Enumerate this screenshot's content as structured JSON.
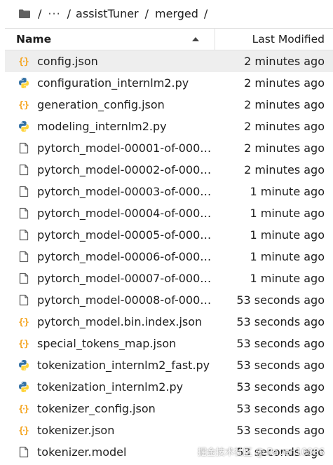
{
  "breadcrumb": {
    "ellipsis": "···",
    "sep1": "/",
    "sep2": "/",
    "sep3": "/",
    "sep4": "/",
    "folder1": "assistTuner",
    "folder2": "merged"
  },
  "header": {
    "name_label": "Name",
    "modified_label": "Last Modified"
  },
  "files": [
    {
      "name": "config.json",
      "modified": "2 minutes ago",
      "icon": "json-icon"
    },
    {
      "name": "configuration_internlm2.py",
      "modified": "2 minutes ago",
      "icon": "python-icon"
    },
    {
      "name": "generation_config.json",
      "modified": "2 minutes ago",
      "icon": "json-icon"
    },
    {
      "name": "modeling_internlm2.py",
      "modified": "2 minutes ago",
      "icon": "python-icon"
    },
    {
      "name": "pytorch_model-00001-of-0000...",
      "modified": "2 minutes ago",
      "icon": "file-icon"
    },
    {
      "name": "pytorch_model-00002-of-0000...",
      "modified": "2 minutes ago",
      "icon": "file-icon"
    },
    {
      "name": "pytorch_model-00003-of-0000...",
      "modified": "1 minute ago",
      "icon": "file-icon"
    },
    {
      "name": "pytorch_model-00004-of-0000...",
      "modified": "1 minute ago",
      "icon": "file-icon"
    },
    {
      "name": "pytorch_model-00005-of-0000...",
      "modified": "1 minute ago",
      "icon": "file-icon"
    },
    {
      "name": "pytorch_model-00006-of-0000...",
      "modified": "1 minute ago",
      "icon": "file-icon"
    },
    {
      "name": "pytorch_model-00007-of-0000...",
      "modified": "1 minute ago",
      "icon": "file-icon"
    },
    {
      "name": "pytorch_model-00008-of-0000...",
      "modified": "53 seconds ago",
      "icon": "file-icon"
    },
    {
      "name": "pytorch_model.bin.index.json",
      "modified": "53 seconds ago",
      "icon": "json-icon"
    },
    {
      "name": "special_tokens_map.json",
      "modified": "53 seconds ago",
      "icon": "json-icon"
    },
    {
      "name": "tokenization_internlm2_fast.py",
      "modified": "53 seconds ago",
      "icon": "python-icon"
    },
    {
      "name": "tokenization_internlm2.py",
      "modified": "53 seconds ago",
      "icon": "python-icon"
    },
    {
      "name": "tokenizer_config.json",
      "modified": "53 seconds ago",
      "icon": "json-icon"
    },
    {
      "name": "tokenizer.json",
      "modified": "53 seconds ago",
      "icon": "json-icon"
    },
    {
      "name": "tokenizer.model",
      "modified": "53 seconds ago",
      "icon": "file-icon"
    }
  ],
  "selected_index": 0,
  "watermark": "掘金技术社区 @ Raven10086",
  "colors": {
    "json_icon": "#f5a623",
    "python_blue": "#3572a5",
    "python_yellow": "#ffd43b",
    "file_icon": "#616161",
    "selected_row": "#eeeeee"
  }
}
